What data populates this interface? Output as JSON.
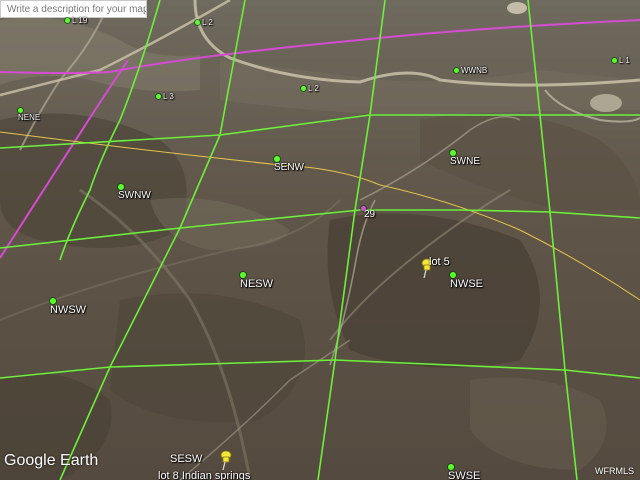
{
  "search": {
    "placeholder": "Write a description for your map"
  },
  "colors": {
    "grid_line": "#6cf03a",
    "boundary_line": "#d64bd4",
    "road_line": "#e8c54a",
    "marker": "#5bff2d",
    "pin": "#f5e63a"
  },
  "markers": {
    "l19": "L 19",
    "l2_top": "L 2",
    "l3": "L 3",
    "l2_mid": "L 2",
    "wwnb": "WWNB",
    "l1": "L 1",
    "nene": "NENE",
    "senw": "SENW",
    "swne": "SWNE",
    "swnw": "SWNW",
    "section_29": "29",
    "nesw": "NESW",
    "nwse": "NWSE",
    "nwsw": "NWSW",
    "sese": "SWSE"
  },
  "labels": {
    "lot5": "lot 5",
    "sesw": "SESW",
    "lot8": "lot 8 Indian springs"
  },
  "logo": {
    "text": "Google Earth"
  },
  "credit": {
    "text": "WFRMLS"
  }
}
